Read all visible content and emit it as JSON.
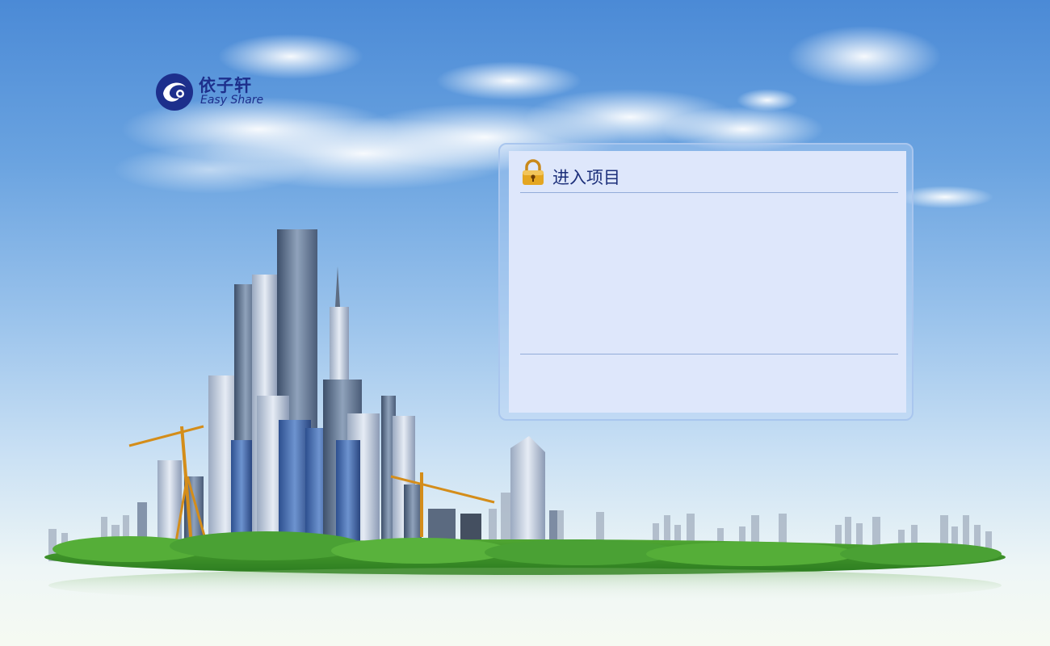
{
  "brand": {
    "name_cn": "依子轩",
    "name_en": "Easy Share"
  },
  "panel": {
    "title": "进入项目"
  },
  "icons": {
    "logo": "swirl-logo-icon",
    "panel": "padlock-icon"
  },
  "colors": {
    "sky_top": "#4b8ad6",
    "sky_bottom": "#f6faf2",
    "brand": "#1d2f8c",
    "panel_bg": "#dee7fb",
    "panel_border": "#a9c6ee",
    "divider": "#93acd9",
    "lock_gold": "#e4a621"
  }
}
